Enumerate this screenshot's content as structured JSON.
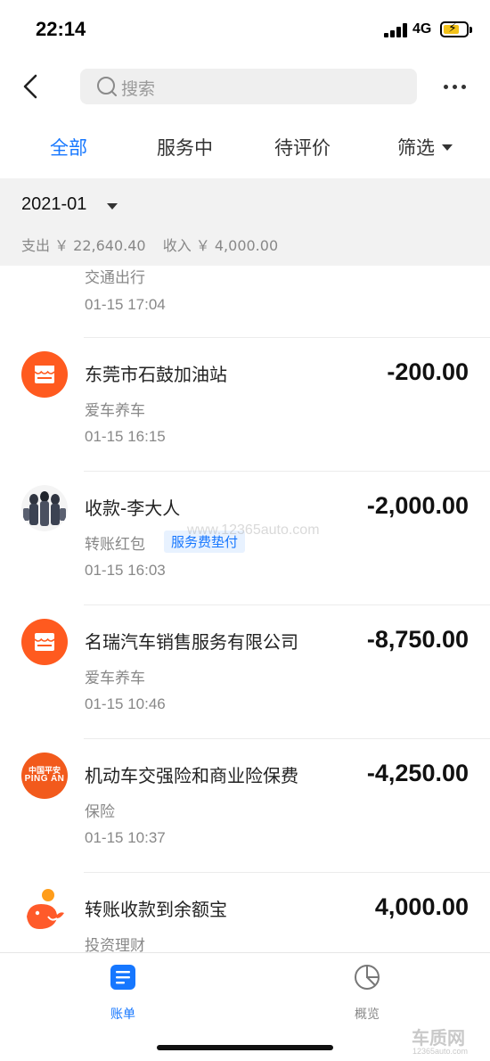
{
  "status_bar": {
    "time": "22:14",
    "network": "4G"
  },
  "nav": {
    "search_placeholder": "搜索"
  },
  "tabs": [
    {
      "label": "全部",
      "active": true
    },
    {
      "label": "服务中",
      "active": false
    },
    {
      "label": "待评价",
      "active": false
    },
    {
      "label": "筛选",
      "active": false
    }
  ],
  "month": {
    "label": "2021-01",
    "expense": "支出 ￥ 22,640.40",
    "income": "收入 ￥ 4,000.00"
  },
  "transactions": [
    {
      "title": "",
      "category": "交通出行",
      "time": "01-15  17:04",
      "amount": "",
      "icon": "none"
    },
    {
      "title": "东莞市石鼓加油站",
      "category": "爱车养车",
      "time": "01-15  16:15",
      "amount": "-200.00",
      "icon": "store-icon"
    },
    {
      "title": "收款-李大人",
      "category": "转账红包",
      "tag": "服务费垫付",
      "time": "01-15  16:03",
      "amount": "-2,000.00",
      "icon": "avatar"
    },
    {
      "title": "名瑞汽车销售服务有限公司",
      "category": "爱车养车",
      "time": "01-15  10:46",
      "amount": "-8,750.00",
      "icon": "store-icon"
    },
    {
      "title": "机动车交强险和商业险保费",
      "category": "保险",
      "time": "01-15  10:37",
      "amount": "-4,250.00",
      "icon": "pingan-logo",
      "logo_line1": "中国平安",
      "logo_line2": "PING AN"
    },
    {
      "title": "转账收款到余额宝",
      "category": "投资理财",
      "time": "",
      "amount": "4,000.00",
      "icon": "yuebao-icon"
    }
  ],
  "bottom_tabs": [
    {
      "label": "账单",
      "active": true
    },
    {
      "label": "概览",
      "active": false
    }
  ],
  "watermark": {
    "text": "车质网",
    "sub": "12365auto.com",
    "mid": "www.12365auto.com"
  },
  "colors": {
    "accent": "#1677ff",
    "store": "#ff5a1f",
    "pingan": "#f25a1c",
    "header_bg": "#f2f2f2"
  }
}
